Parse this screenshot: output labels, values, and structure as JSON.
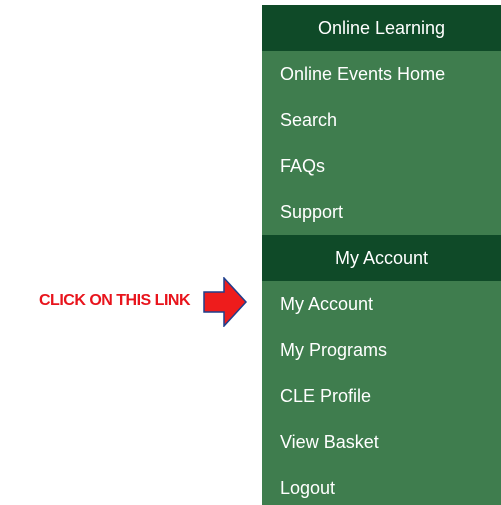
{
  "annotation": {
    "text": "CLICK ON THIS LINK",
    "color": "#e8141c",
    "arrow_icon": "red-right-arrow"
  },
  "menu": {
    "background": "#3f7d4e",
    "header_background": "#0f4a28",
    "sections": [
      {
        "title": "Online Learning",
        "items": [
          {
            "label": "Online Events Home"
          },
          {
            "label": "Search"
          },
          {
            "label": "FAQs"
          },
          {
            "label": "Support"
          }
        ]
      },
      {
        "title": "My Account",
        "items": [
          {
            "label": "My Account"
          },
          {
            "label": "My Programs"
          },
          {
            "label": "CLE Profile"
          },
          {
            "label": "View Basket"
          },
          {
            "label": "Logout"
          }
        ]
      }
    ]
  }
}
